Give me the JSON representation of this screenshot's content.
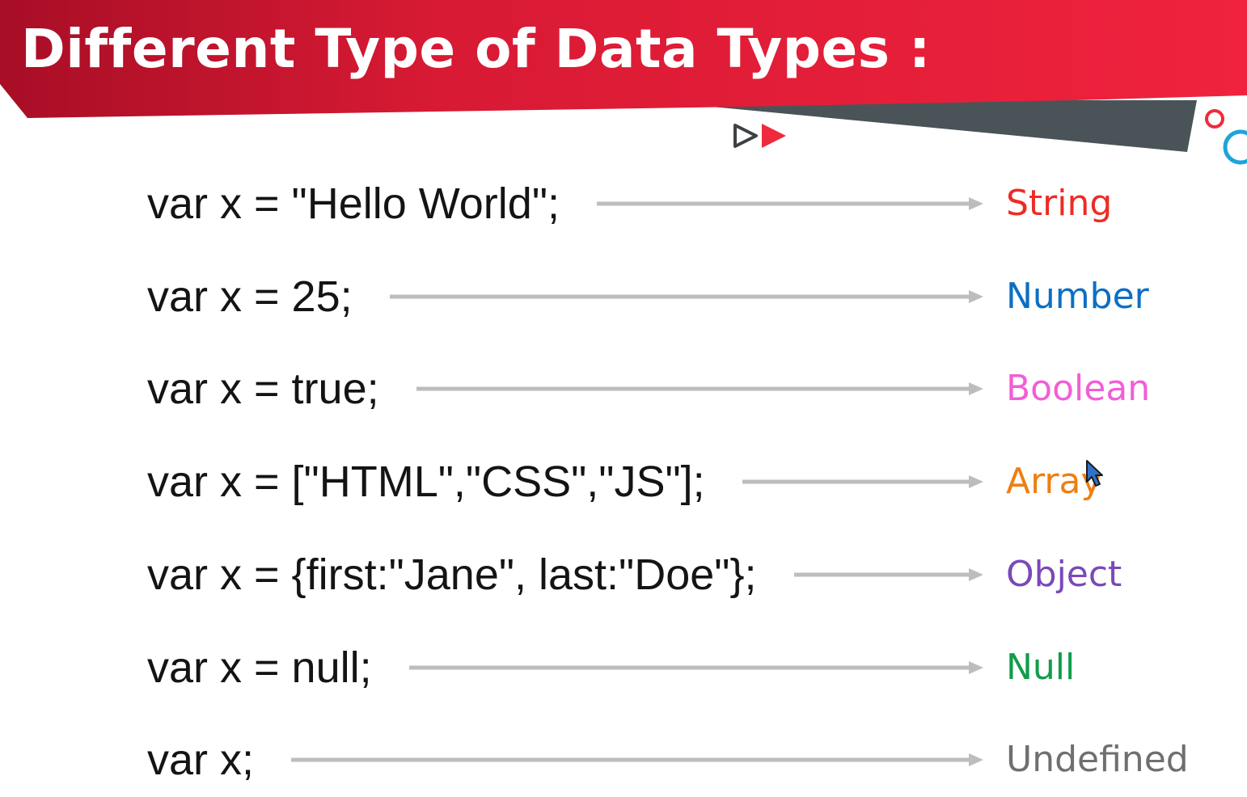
{
  "title": "Different Type of Data Types :",
  "colors": {
    "banner_red": "#e8203a",
    "banner_dark_red": "#b01028",
    "banner_gray": "#4a5458",
    "arrow_gray": "#bdbdbd",
    "code_text": "#141414"
  },
  "decorations": {
    "play_icons": [
      "outline-play-icon",
      "filled-play-icon"
    ],
    "circles": [
      "red-ring-icon",
      "blue-ring-icon"
    ]
  },
  "rows": [
    {
      "code": "var x = \"Hello World\";",
      "type": "String",
      "color": "#ee2b24"
    },
    {
      "code": "var x = 25;",
      "type": "Number",
      "color": "#0b6fc4"
    },
    {
      "code": "var x = true;",
      "type": "Boolean",
      "color": "#f25ed6"
    },
    {
      "code": "var x = [\"HTML\",\"CSS\",\"JS\"];",
      "type": "Array",
      "color": "#ee7f12"
    },
    {
      "code": "var x = {first:\"Jane\", last:\"Doe\"};",
      "type": "Object",
      "color": "#7a49b8"
    },
    {
      "code": "var x = null;",
      "type": "Null",
      "color": "#0f9d4a"
    },
    {
      "code": "var x;",
      "type": "Undefined",
      "color": "#6f6f6f"
    }
  ]
}
